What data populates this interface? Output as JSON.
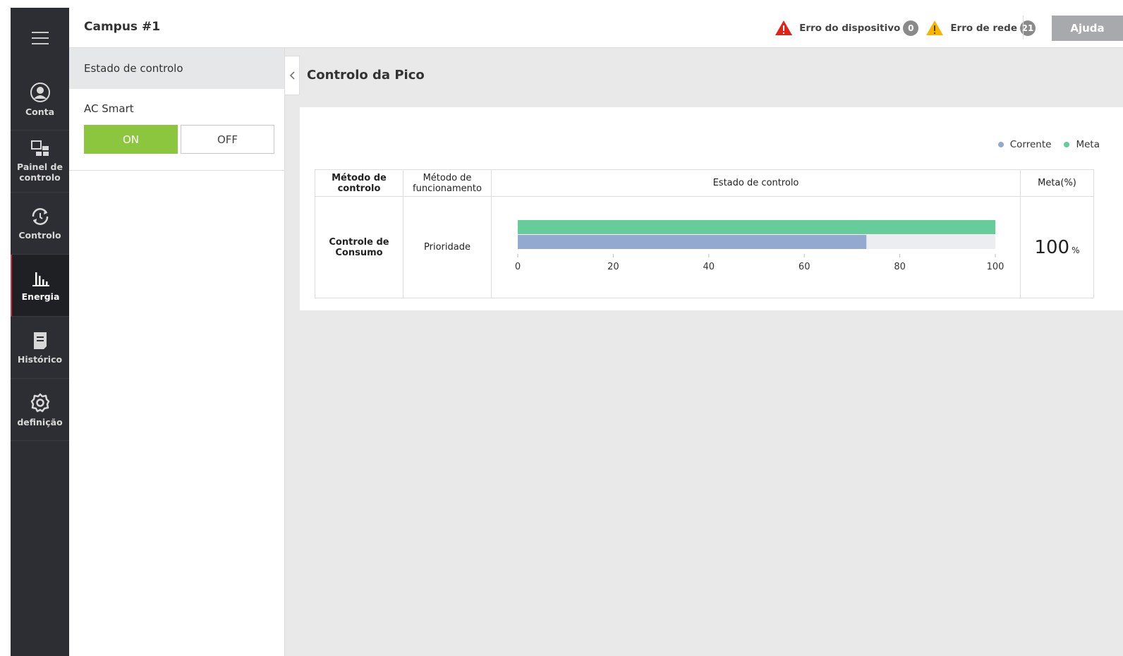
{
  "header": {
    "title": "Campus #1",
    "device_error_label": "Erro do dispositivo",
    "device_error_count": "0",
    "network_error_label": "Erro de rede",
    "network_error_count": "21",
    "help_label": "Ajuda"
  },
  "sidebar": {
    "items": [
      {
        "label": "Conta",
        "icon": "account-icon"
      },
      {
        "label": "Painel de controlo",
        "icon": "dashboard-icon"
      },
      {
        "label": "Controlo",
        "icon": "control-icon"
      },
      {
        "label": "Energia",
        "icon": "energy-icon",
        "active": true
      },
      {
        "label": "Histórico",
        "icon": "history-icon"
      },
      {
        "label": "definição",
        "icon": "gear-icon"
      }
    ]
  },
  "panel": {
    "header": "Estado de controlo",
    "ac_smart_label": "AC Smart",
    "on_label": "ON",
    "off_label": "OFF",
    "selected": "ON"
  },
  "main": {
    "title": "Controlo da Pico",
    "legend": {
      "current": "Corrente",
      "target": "Meta"
    },
    "table": {
      "headers": [
        "Método de controlo",
        "Método de funcionamento",
        "Estado de controlo",
        "Meta(%)"
      ],
      "row": {
        "method": "Controle de Consumo",
        "operation": "Prioridade",
        "target_value": "100",
        "target_unit": "%"
      }
    }
  },
  "colors": {
    "current": "#94a9cf",
    "target": "#66cc99",
    "on_button": "#8cc63f",
    "active_nav_marker": "#e0283c"
  },
  "chart_data": {
    "type": "bar",
    "orientation": "horizontal",
    "categories": [
      ""
    ],
    "series": [
      {
        "name": "Meta",
        "values": [
          100
        ]
      },
      {
        "name": "Corrente",
        "values": [
          73
        ]
      }
    ],
    "xlim": [
      0,
      100
    ],
    "x_ticks": [
      0,
      20,
      40,
      60,
      80,
      100
    ],
    "legend": "top-right"
  }
}
